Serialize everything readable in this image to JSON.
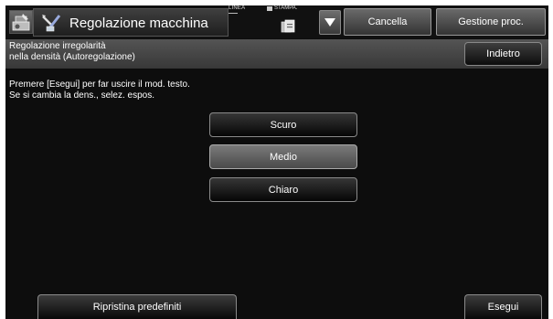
{
  "header": {
    "title": "Regolazione macchina",
    "status_linea": "LINEA",
    "status_stampa": "STAMPA.",
    "cancel_label": "Cancella",
    "job_status_label": "Gestione proc."
  },
  "subheader": {
    "title_line1": "Regolazione irregolarità",
    "title_line2": "nella densità (Autoregolazione)",
    "back_label": "Indietro"
  },
  "main": {
    "instruction_line1": "Premere [Esegui] per far uscire il mod. testo.",
    "instruction_line2": "Se si cambia la dens., selez. espos.",
    "options": [
      {
        "label": "Scuro",
        "selected": false
      },
      {
        "label": "Medio",
        "selected": true
      },
      {
        "label": "Chiaro",
        "selected": false
      }
    ]
  },
  "footer": {
    "reset_label": "Ripristina predefiniti",
    "execute_label": "Esegui"
  },
  "icons": {
    "machine": "machine-settings-icon",
    "title": "adjust-tools-icon",
    "print": "print-job-icon",
    "dropdown": "triangle-down-icon"
  }
}
